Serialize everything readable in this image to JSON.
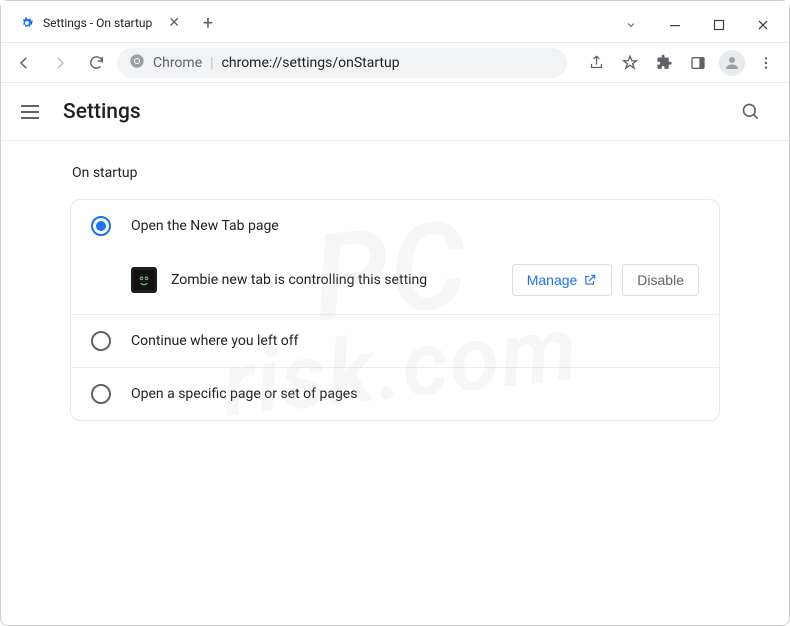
{
  "window": {
    "tab_title": "Settings - On startup"
  },
  "omnibox": {
    "prefix": "Chrome",
    "separator": " | ",
    "path": "chrome://settings/onStartup"
  },
  "header": {
    "title": "Settings"
  },
  "section": {
    "label": "On startup"
  },
  "options": {
    "opt1": "Open the New Tab page",
    "opt2": "Continue where you left off",
    "opt3": "Open a specific page or set of pages"
  },
  "extension": {
    "message": "Zombie new tab is controlling this setting",
    "manage": "Manage",
    "disable": "Disable"
  },
  "watermark": {
    "line1": "PC",
    "line2": "risk.com"
  }
}
